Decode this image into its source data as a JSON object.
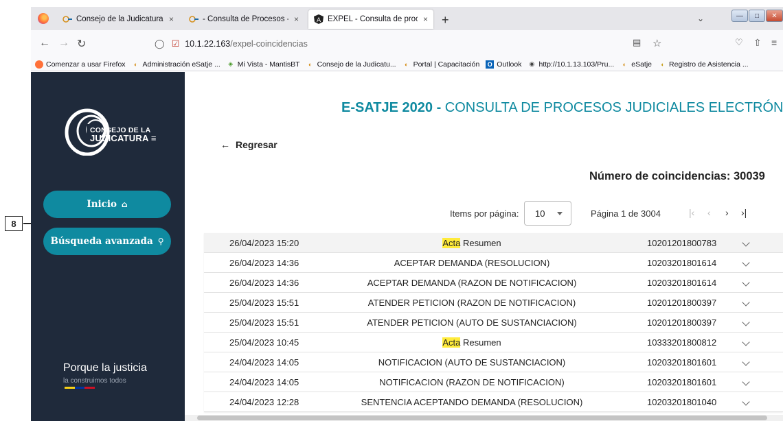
{
  "annotation": {
    "label": "8"
  },
  "browser": {
    "tabs": [
      {
        "title": "Consejo de la Judicatura | Cons",
        "active": false
      },
      {
        "title": "- Consulta de Procesos - eSATJE",
        "active": false
      },
      {
        "title": "EXPEL - Consulta de procesos",
        "active": true
      }
    ],
    "new_tab": "+",
    "close_glyph": "×",
    "url_host": "10.1.22.163",
    "url_path": "/expel-coincidencias",
    "bookmarks": [
      "Comenzar a usar Firefox",
      "Administración eSatje ...",
      "Mi Vista - MantisBT",
      "Consejo de la Judicatu...",
      "Portal | Capacitación",
      "Outlook",
      "http://10.1.13.103/Pru...",
      "eSatje",
      "Registro de Asistencia ..."
    ]
  },
  "sidebar": {
    "logo_line1": "CONSEJO DE LA",
    "logo_line2": "JUDICATURA",
    "inicio_label": "Inicio",
    "busqueda_label": "Búsqueda avanzada",
    "slogan": "Porque la justicia",
    "slogan_sub": "la construimos todos",
    "flag_colors": [
      "#f7d117",
      "#0033a0",
      "#ce1126"
    ]
  },
  "main": {
    "title_bold": "E-SATJE 2020 -",
    "title_rest": " CONSULTA DE PROCESOS JUDICIALES ELECTRÓNICOS",
    "back_label": "Regresar",
    "count_label": "Número de coincidencias: 30039",
    "items_per_page_label": "Items por página:",
    "items_per_page_value": "10",
    "page_info": "Página 1 de 3004",
    "rows": [
      {
        "date": "26/04/2023 15:20",
        "hl": "Acta",
        "desc": " Resumen",
        "num": "10201201800783"
      },
      {
        "date": "26/04/2023 14:36",
        "hl": "",
        "desc": "ACEPTAR DEMANDA (RESOLUCION)",
        "num": "10203201801614"
      },
      {
        "date": "26/04/2023 14:36",
        "hl": "",
        "desc": "ACEPTAR DEMANDA (RAZON DE NOTIFICACION)",
        "num": "10203201801614"
      },
      {
        "date": "25/04/2023 15:51",
        "hl": "",
        "desc": "ATENDER PETICION (RAZON DE NOTIFICACION)",
        "num": "10201201800397"
      },
      {
        "date": "25/04/2023 15:51",
        "hl": "",
        "desc": "ATENDER PETICION (AUTO DE SUSTANCIACION)",
        "num": "10201201800397"
      },
      {
        "date": "25/04/2023 10:45",
        "hl": "Acta",
        "desc": " Resumen",
        "num": "10333201800812"
      },
      {
        "date": "24/04/2023 14:05",
        "hl": "",
        "desc": "NOTIFICACION (AUTO DE SUSTANCIACION)",
        "num": "10203201801601"
      },
      {
        "date": "24/04/2023 14:05",
        "hl": "",
        "desc": "NOTIFICACION (RAZON DE NOTIFICACION)",
        "num": "10203201801601"
      },
      {
        "date": "24/04/2023 12:28",
        "hl": "",
        "desc": "SENTENCIA ACEPTANDO DEMANDA (RESOLUCION)",
        "num": "10203201801040"
      }
    ]
  },
  "colors": {
    "accent": "#0f8aa0",
    "sidebar_bg": "#1f2a3b",
    "highlight": "#ffeb3b"
  }
}
